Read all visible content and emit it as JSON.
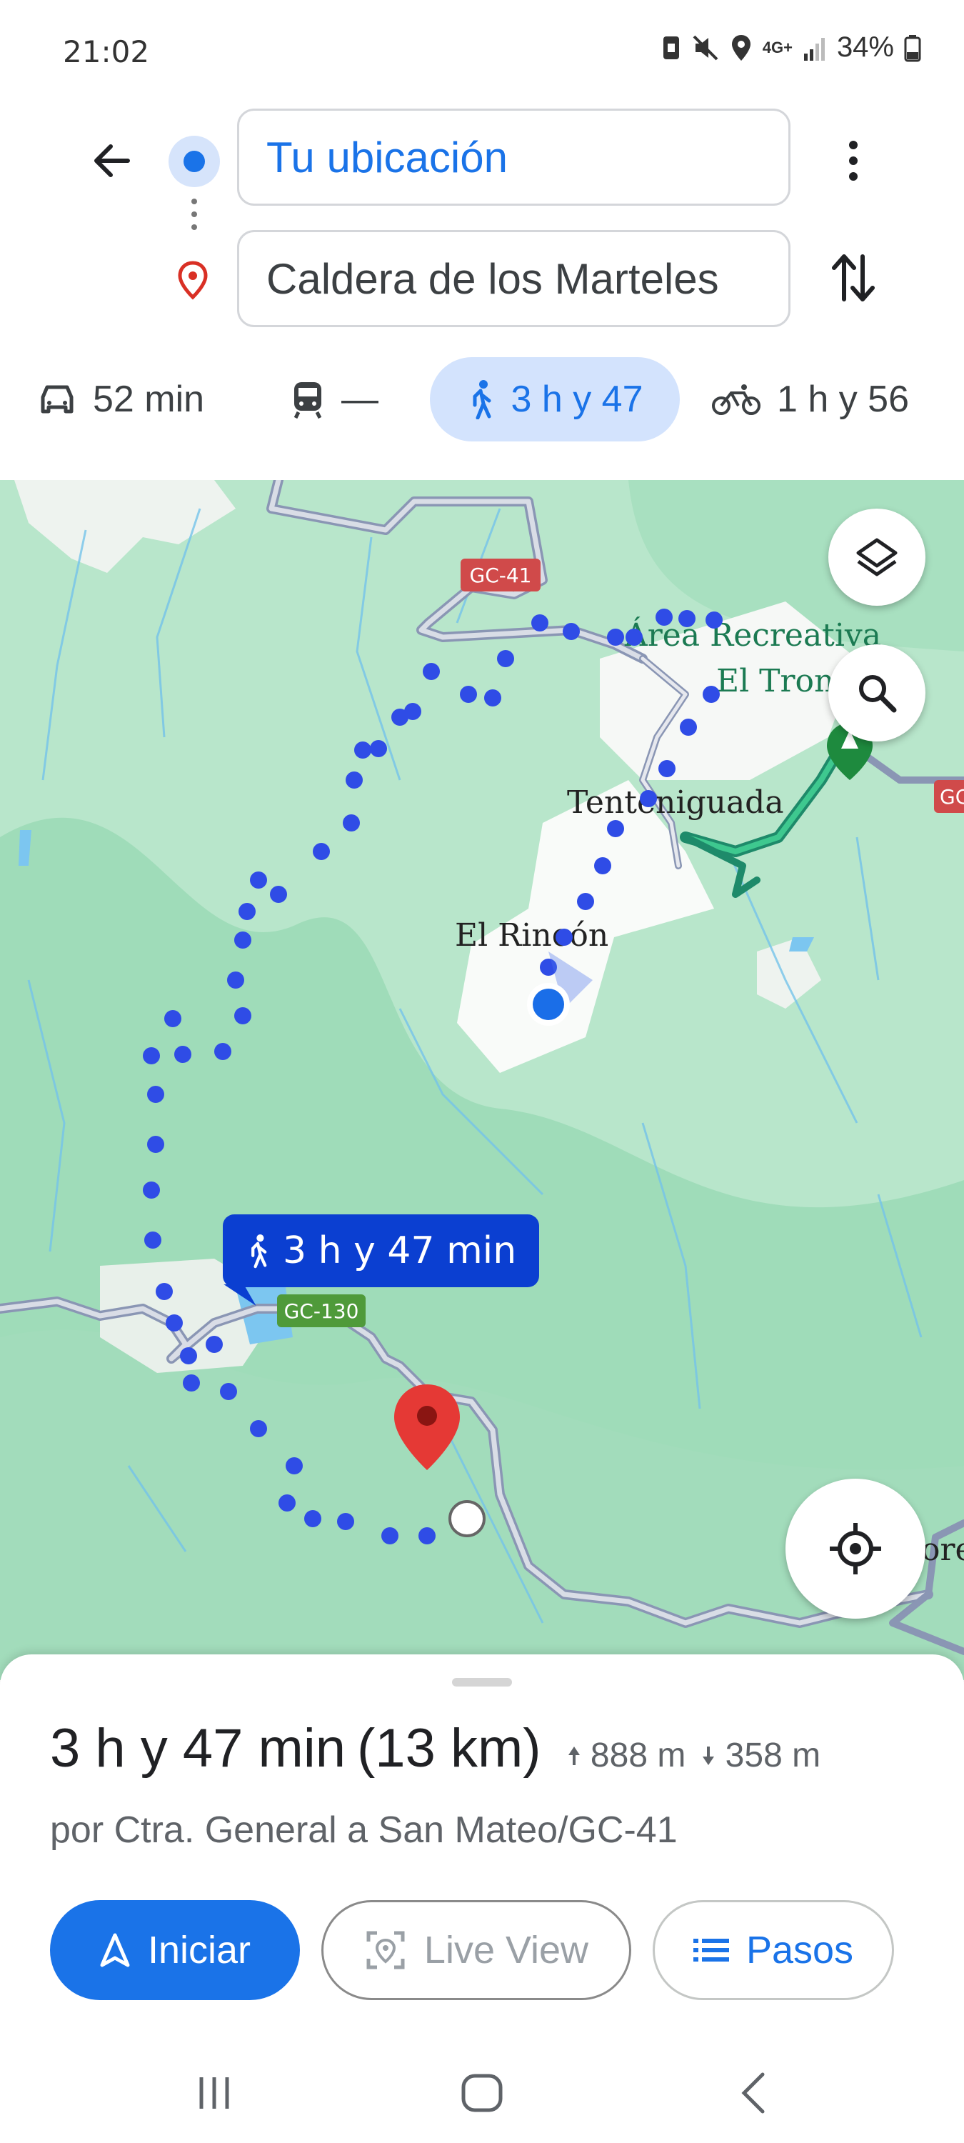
{
  "status_bar": {
    "time": "21:02",
    "network": "4G+",
    "battery": "34%"
  },
  "header": {
    "origin_value": "Tu ubicación",
    "destination_value": "Caldera de los Marteles"
  },
  "modes": [
    {
      "name": "car",
      "label": "52 min"
    },
    {
      "name": "transit",
      "label": "—"
    },
    {
      "name": "walk",
      "label": "3 h y 47",
      "selected": true
    },
    {
      "name": "bike",
      "label": "1 h y 56"
    }
  ],
  "map": {
    "road_gc41": "GC-41",
    "road_gc130": "GC-130",
    "place_area": "Área Recreativa",
    "place_tron": "El Tron",
    "place_tenteniguada": "Tenteniguada",
    "place_rincon": "El Rincón",
    "edge_gc": "GC",
    "edge_ore": "ore",
    "route_badge": "3 h y 47 min"
  },
  "sheet": {
    "duration": "3 h y 47 min",
    "distance": "(13 km)",
    "ascent": "888 m",
    "descent": "358 m",
    "via": "por Ctra. General a San Mateo/GC-41",
    "start_label": "Iniciar",
    "live_view_label": "Live View",
    "steps_label": "Pasos"
  },
  "colors": {
    "accent": "#1a73e8",
    "route_dots": "#2f4ce6",
    "map_green": "#bde8cf",
    "destination_pin": "#d93025"
  }
}
